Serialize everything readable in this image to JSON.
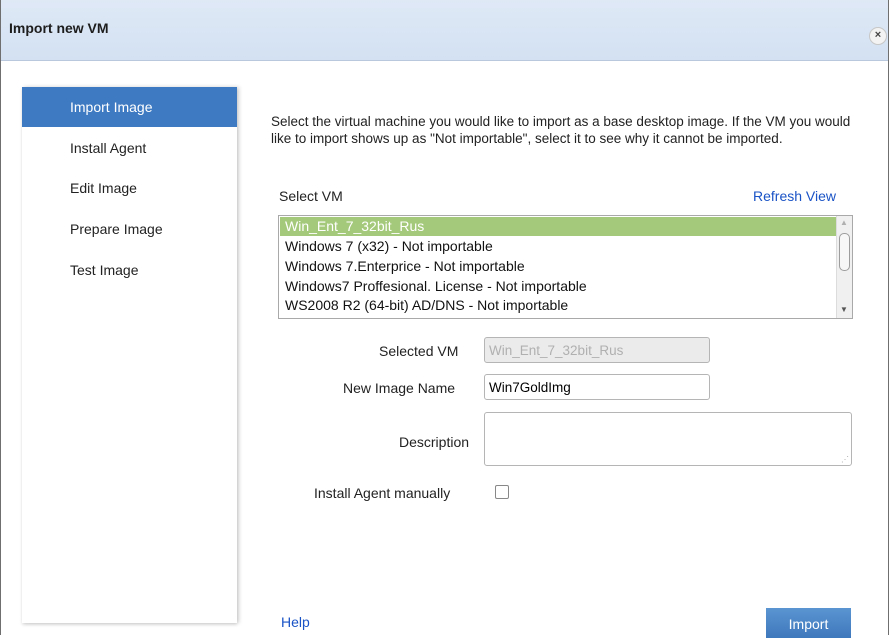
{
  "dialog": {
    "title": "Import new VM",
    "close_label": "×"
  },
  "sidebar": {
    "items": [
      {
        "label": "Import Image",
        "active": true
      },
      {
        "label": "Install Agent"
      },
      {
        "label": "Edit Image"
      },
      {
        "label": "Prepare Image"
      },
      {
        "label": "Test Image"
      }
    ]
  },
  "main": {
    "intro": "Select the virtual machine you would like to import as a base desktop image. If the VM you would like to import shows up as \"Not importable\", select it to see why it cannot be imported.",
    "select_vm_label": "Select VM",
    "refresh_label": "Refresh View",
    "vm_list": [
      "Win_Ent_7_32bit_Rus",
      "Windows 7 (x32) - Not importable",
      "Windows 7.Enterprice - Not importable",
      "Windows7 Proffesional. License - Not importable",
      "WS2008 R2 (64-bit) AD/DNS - Not importable"
    ],
    "selected_vm_index": 0,
    "form": {
      "selected_vm_label": "Selected VM",
      "selected_vm_value": "Win_Ent_7_32bit_Rus",
      "new_image_name_label": "New Image Name",
      "new_image_name_value": "Win7GoldImg",
      "description_label": "Description",
      "description_value": "",
      "install_agent_label": "Install Agent manually",
      "install_agent_checked": false
    }
  },
  "footer": {
    "help_label": "Help",
    "import_label": "Import"
  },
  "colors": {
    "accent": "#3e7ac2",
    "selection": "#a4c97a",
    "link": "#1a53c6"
  }
}
